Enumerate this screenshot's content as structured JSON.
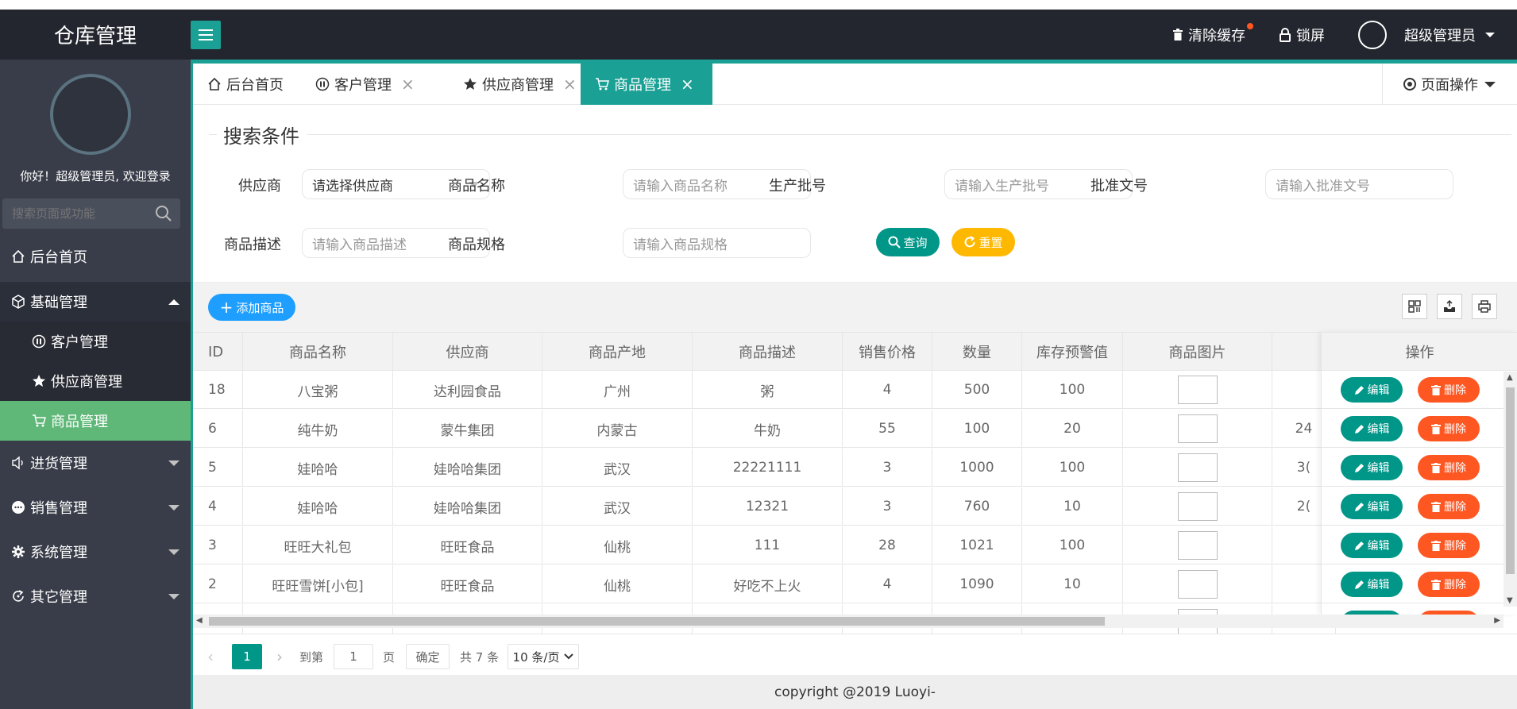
{
  "app": {
    "title": "仓库管理"
  },
  "header": {
    "clear_cache": "清除缓存",
    "lock_screen": "锁屏",
    "user_name": "超级管理员"
  },
  "sidebar": {
    "greeting": "你好！超级管理员, 欢迎登录",
    "search_placeholder": "搜索页面或功能",
    "items": [
      {
        "label": "后台首页",
        "icon": "home-icon"
      },
      {
        "label": "基础管理",
        "icon": "cube-icon",
        "expanded": true
      },
      {
        "label": "进货管理",
        "icon": "speaker-icon"
      },
      {
        "label": "销售管理",
        "icon": "chat-icon"
      },
      {
        "label": "系统管理",
        "icon": "gear-icon"
      },
      {
        "label": "其它管理",
        "icon": "refresh-icon"
      }
    ],
    "subitems": [
      {
        "label": "客户管理",
        "icon": "pause-icon"
      },
      {
        "label": "供应商管理",
        "icon": "star-icon"
      },
      {
        "label": "商品管理",
        "icon": "cart-icon",
        "active": true
      }
    ]
  },
  "tabs": [
    {
      "label": "后台首页",
      "icon": "home-icon"
    },
    {
      "label": "客户管理",
      "icon": "pause-icon"
    },
    {
      "label": "供应商管理",
      "icon": "star-icon"
    },
    {
      "label": "商品管理",
      "icon": "cart-icon",
      "active": true
    }
  ],
  "page_ops": "页面操作",
  "search": {
    "legend": "搜索条件",
    "supplier_label": "供应商",
    "supplier_value": "请选择供应商",
    "name_label": "商品名称",
    "name_placeholder": "请输入商品名称",
    "batch_label": "生产批号",
    "batch_placeholder": "请输入生产批号",
    "approval_label": "批准文号",
    "approval_placeholder": "请输入批准文号",
    "desc_label": "商品描述",
    "desc_placeholder": "请输入商品描述",
    "spec_label": "商品规格",
    "spec_placeholder": "请输入商品规格",
    "query": "查询",
    "reset": "重置"
  },
  "toolbar": {
    "add": "添加商品"
  },
  "table": {
    "columns": [
      "ID",
      "商品名称",
      "供应商",
      "商品产地",
      "商品描述",
      "销售价格",
      "数量",
      "库存预警值",
      "商品图片",
      "操作"
    ],
    "edit": "编辑",
    "delete": "删除",
    "rows": [
      {
        "id": "18",
        "name": "八宝粥",
        "supplier": "达利园食品",
        "origin": "广州",
        "desc": "粥",
        "price": "4",
        "qty": "500",
        "warn": "100",
        "extra": ""
      },
      {
        "id": "6",
        "name": "纯牛奶",
        "supplier": "蒙牛集团",
        "origin": "内蒙古",
        "desc": "牛奶",
        "price": "55",
        "qty": "100",
        "warn": "20",
        "extra": "24"
      },
      {
        "id": "5",
        "name": "娃哈哈",
        "supplier": "娃哈哈集团",
        "origin": "武汉",
        "desc": "22221111",
        "price": "3",
        "qty": "1000",
        "warn": "100",
        "extra": "3("
      },
      {
        "id": "4",
        "name": "娃哈哈",
        "supplier": "娃哈哈集团",
        "origin": "武汉",
        "desc": "12321",
        "price": "3",
        "qty": "760",
        "warn": "10",
        "extra": "2("
      },
      {
        "id": "3",
        "name": "旺旺大礼包",
        "supplier": "旺旺食品",
        "origin": "仙桃",
        "desc": "111",
        "price": "28",
        "qty": "1021",
        "warn": "100",
        "extra": ""
      },
      {
        "id": "2",
        "name": "旺旺雪饼[小包]",
        "supplier": "旺旺食品",
        "origin": "仙桃",
        "desc": "好吃不上火",
        "price": "4",
        "qty": "1090",
        "warn": "10",
        "extra": ""
      }
    ]
  },
  "pager": {
    "current": "1",
    "goto_label": "到第",
    "goto_value": "1",
    "page_unit": "页",
    "confirm": "确定",
    "total": "共 7 条",
    "size_option": "10 条/页"
  },
  "footer": {
    "text": "copyright @2019 Luoyi-"
  },
  "colors": {
    "accent": "#1aa094",
    "sidebar": "#393d49",
    "active_menu": "#5fb878",
    "danger": "#ff5722",
    "warning": "#ffb800",
    "info": "#1e9fff"
  }
}
